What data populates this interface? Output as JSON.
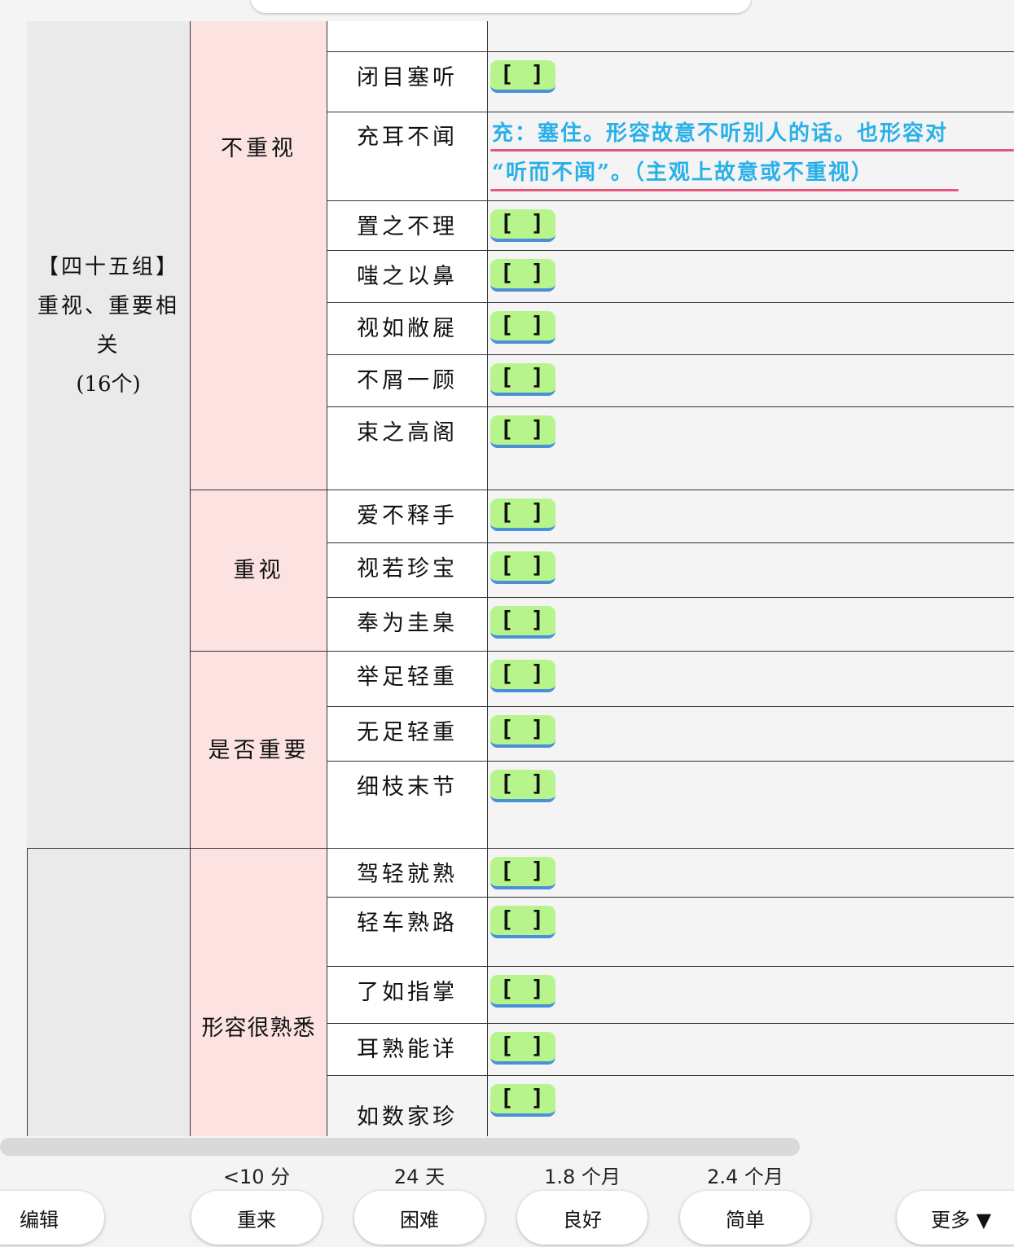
{
  "group": {
    "line1": "【四十五组】",
    "line2": "重视、重要相",
    "line3": "关",
    "line4": "(16个)"
  },
  "categories": {
    "not_value": "不重视",
    "value": "重视",
    "importance": "是否重要",
    "familiar": "形容很熟悉"
  },
  "words": {
    "w_bimu": "闭目塞听",
    "w_chonger": "充耳不闻",
    "w_zhizhi": "置之不理",
    "w_chizhi": "嗤之以鼻",
    "w_shiru": "视如敝屣",
    "w_buxie": "不屑一顾",
    "w_shuzhi": "束之高阁",
    "w_aibu": "爱不释手",
    "w_shiruo": "视若珍宝",
    "w_fengwei": "奉为圭臬",
    "w_juzu": "举足轻重",
    "w_wuzu": "无足轻重",
    "w_xizhi": "细枝末节",
    "w_jiaqing": "驾轻就熟",
    "w_qingche": "轻车熟路",
    "w_liaoru": "了如指掌",
    "w_ershu": "耳熟能详",
    "w_rushu": "如数家珍"
  },
  "cloze_label": "[ ]",
  "answer": {
    "line1": "充：塞住。形容故意不听别人的话。也形容对",
    "line2": "“听而不闻”。（主观上故意或不重视）"
  },
  "intervals": {
    "again": "<10 分",
    "hard": "24 天",
    "good": "1.8 个月",
    "easy": "2.4 个月"
  },
  "buttons": {
    "edit": "编辑",
    "again": "重来",
    "hard": "困难",
    "good": "良好",
    "easy": "简单",
    "more": "更多 ▼"
  },
  "colors": {
    "cloze_fill": "#b7f58c",
    "cloze_underline": "#4a90d9",
    "answer_text": "#2ab0e8",
    "answer_underline": "#e8557a",
    "category_bg": "#fde2e2",
    "group_bg": "#eaeaea"
  }
}
